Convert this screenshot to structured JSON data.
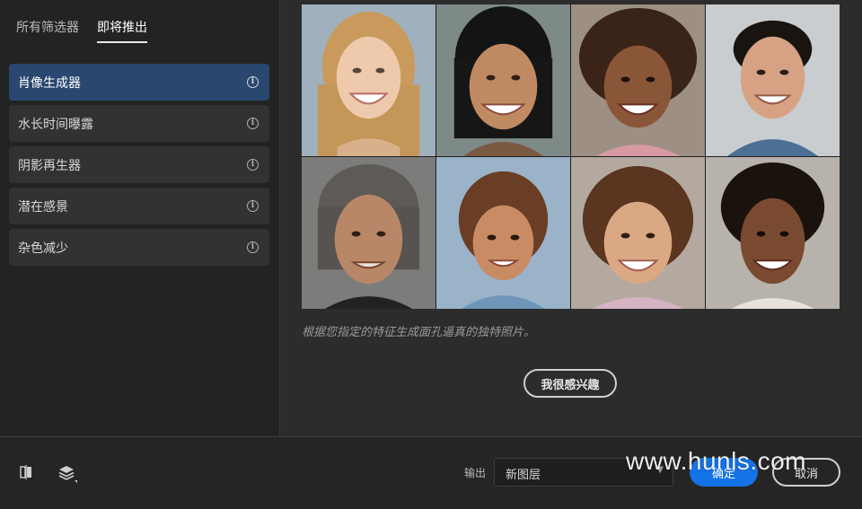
{
  "tabs": [
    {
      "label": "所有筛选器",
      "active": false
    },
    {
      "label": "即将推出",
      "active": true
    }
  ],
  "filters": [
    {
      "label": "肖像生成器",
      "selected": true,
      "icon": "info-icon"
    },
    {
      "label": "水长时间曝露",
      "selected": false,
      "icon": "info-icon"
    },
    {
      "label": "阴影再生器",
      "selected": false,
      "icon": "info-icon"
    },
    {
      "label": "潜在感景",
      "selected": false,
      "icon": "info-icon"
    },
    {
      "label": "杂色减少",
      "selected": false,
      "icon": "info-icon"
    }
  ],
  "preview": {
    "description": "根据您指定的特征生成面孔逼真的独特照片。",
    "interest_button": "我很感兴趣"
  },
  "bottom": {
    "output_label": "输出",
    "output_value": "新图层",
    "confirm_label": "确定",
    "cancel_label": "取消",
    "watermark": "www.hunls.com"
  },
  "colors": {
    "accent": "#1473e6",
    "selected_item": "#2a4770"
  }
}
